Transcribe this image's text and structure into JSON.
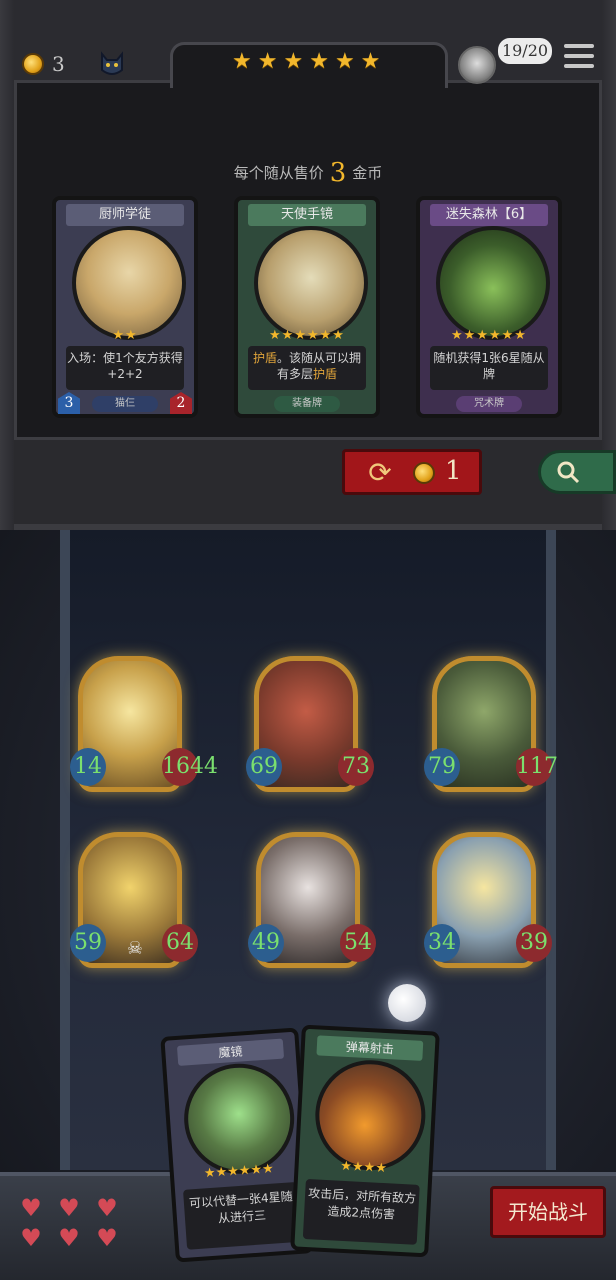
{
  "header": {
    "gold": "3",
    "tier_stars": 6,
    "hero_count": "19/20"
  },
  "shop": {
    "sell_prefix": "每个随从售价",
    "sell_price": "3",
    "sell_suffix": "金币",
    "cards": [
      {
        "title": "厨师学徒",
        "stars": "★★",
        "desc": "入场：使1个友方获得+2+2",
        "tag": "猫仨",
        "attack": "3",
        "health": "2"
      },
      {
        "title": "天使手镜",
        "stars": "★★★★★★",
        "desc_pre": "",
        "desc_hl1": "护盾",
        "desc_mid": "。该随从可以拥有多层",
        "desc_hl2": "护盾",
        "tag": "装备牌"
      },
      {
        "title": "迷失森林【6】",
        "stars": "★★★★★★",
        "desc": "随机获得1张6星随从牌",
        "tag": "咒术牌"
      }
    ],
    "refresh_cost": "1"
  },
  "board": {
    "minions": [
      {
        "attack": "14",
        "health": "1644"
      },
      {
        "attack": "69",
        "health": "73"
      },
      {
        "attack": "79",
        "health": "117"
      },
      {
        "attack": "59",
        "health": "64"
      },
      {
        "attack": "49",
        "health": "54"
      },
      {
        "attack": "34",
        "health": "39"
      }
    ]
  },
  "hand": [
    {
      "title": "魔镜",
      "stars": "★★★★★★",
      "desc": "可以代替一张4星随从进行三"
    },
    {
      "title": "弹幕射击",
      "stars": "★★★★",
      "desc": "攻击后，对所有敌方造成2点伤害"
    }
  ],
  "lives": [
    "♥",
    "♥",
    "♥",
    "♥",
    "♥",
    "♥"
  ],
  "start_button": "开始战斗",
  "colors": {
    "gold": "#f2b72c",
    "stat_green": "#7be06e",
    "button_red": "#a31a1e"
  }
}
